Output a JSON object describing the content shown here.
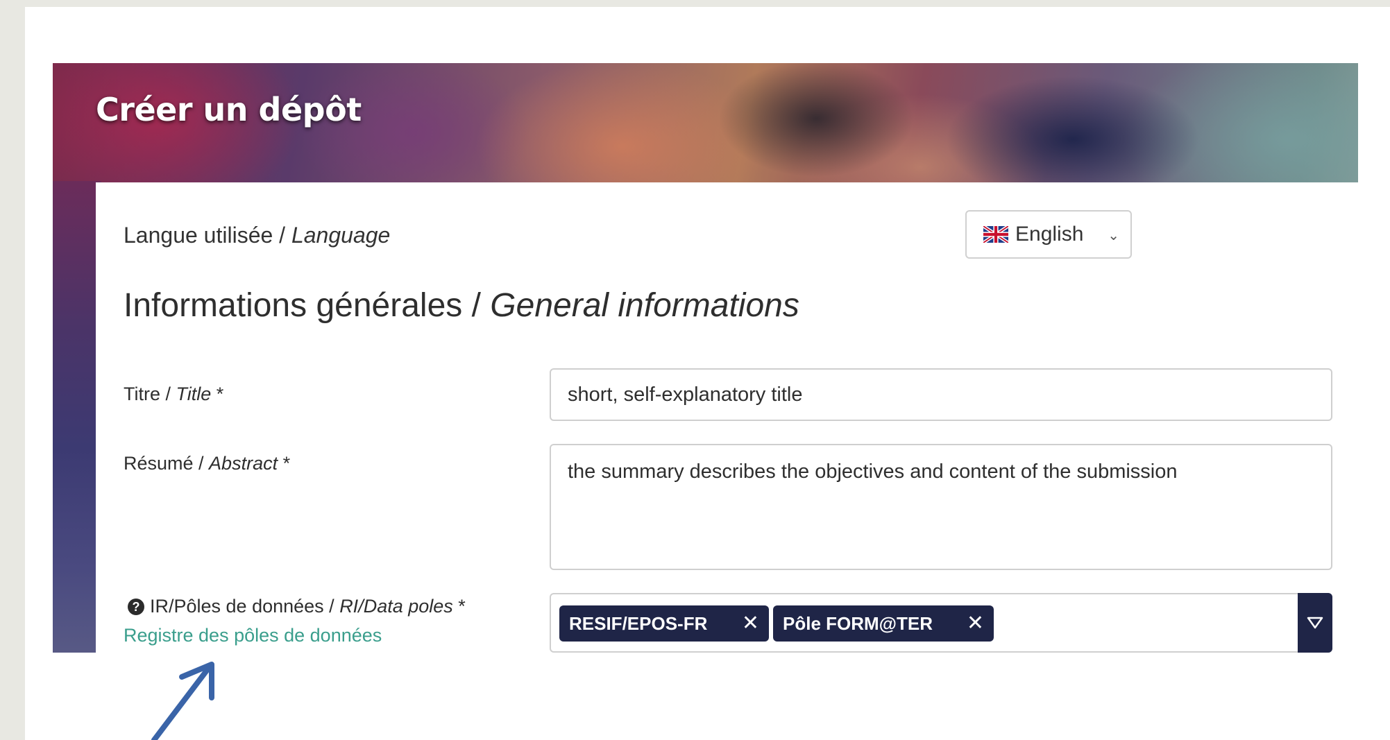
{
  "banner": {
    "title": "Créer un dépôt"
  },
  "language": {
    "label_fr": "Langue utilisée / ",
    "label_en": "Language",
    "selected": "English"
  },
  "section": {
    "title_fr": "Informations générales / ",
    "title_en": "General informations"
  },
  "fields": {
    "title": {
      "label_fr": "Titre / ",
      "label_en": "Title",
      "required": " *",
      "value": "short, self-explanatory title"
    },
    "abstract": {
      "label_fr": "Résumé / ",
      "label_en": "Abstract",
      "required": " *",
      "value": "the summary describes the objectives and content of the submission"
    },
    "data_poles": {
      "label_fr": "IR/Pôles de données / ",
      "label_en": "RI/Data poles",
      "required": " *",
      "help_icon": "?",
      "tags": [
        "RESIF/EPOS-FR",
        "Pôle FORM@TER"
      ],
      "remove_glyph": "✕",
      "registry_link": "Registre des pôles de données"
    }
  },
  "colors": {
    "tag_bg": "#1f2547",
    "link": "#3a9e8c",
    "arrow": "#3a64a8"
  }
}
